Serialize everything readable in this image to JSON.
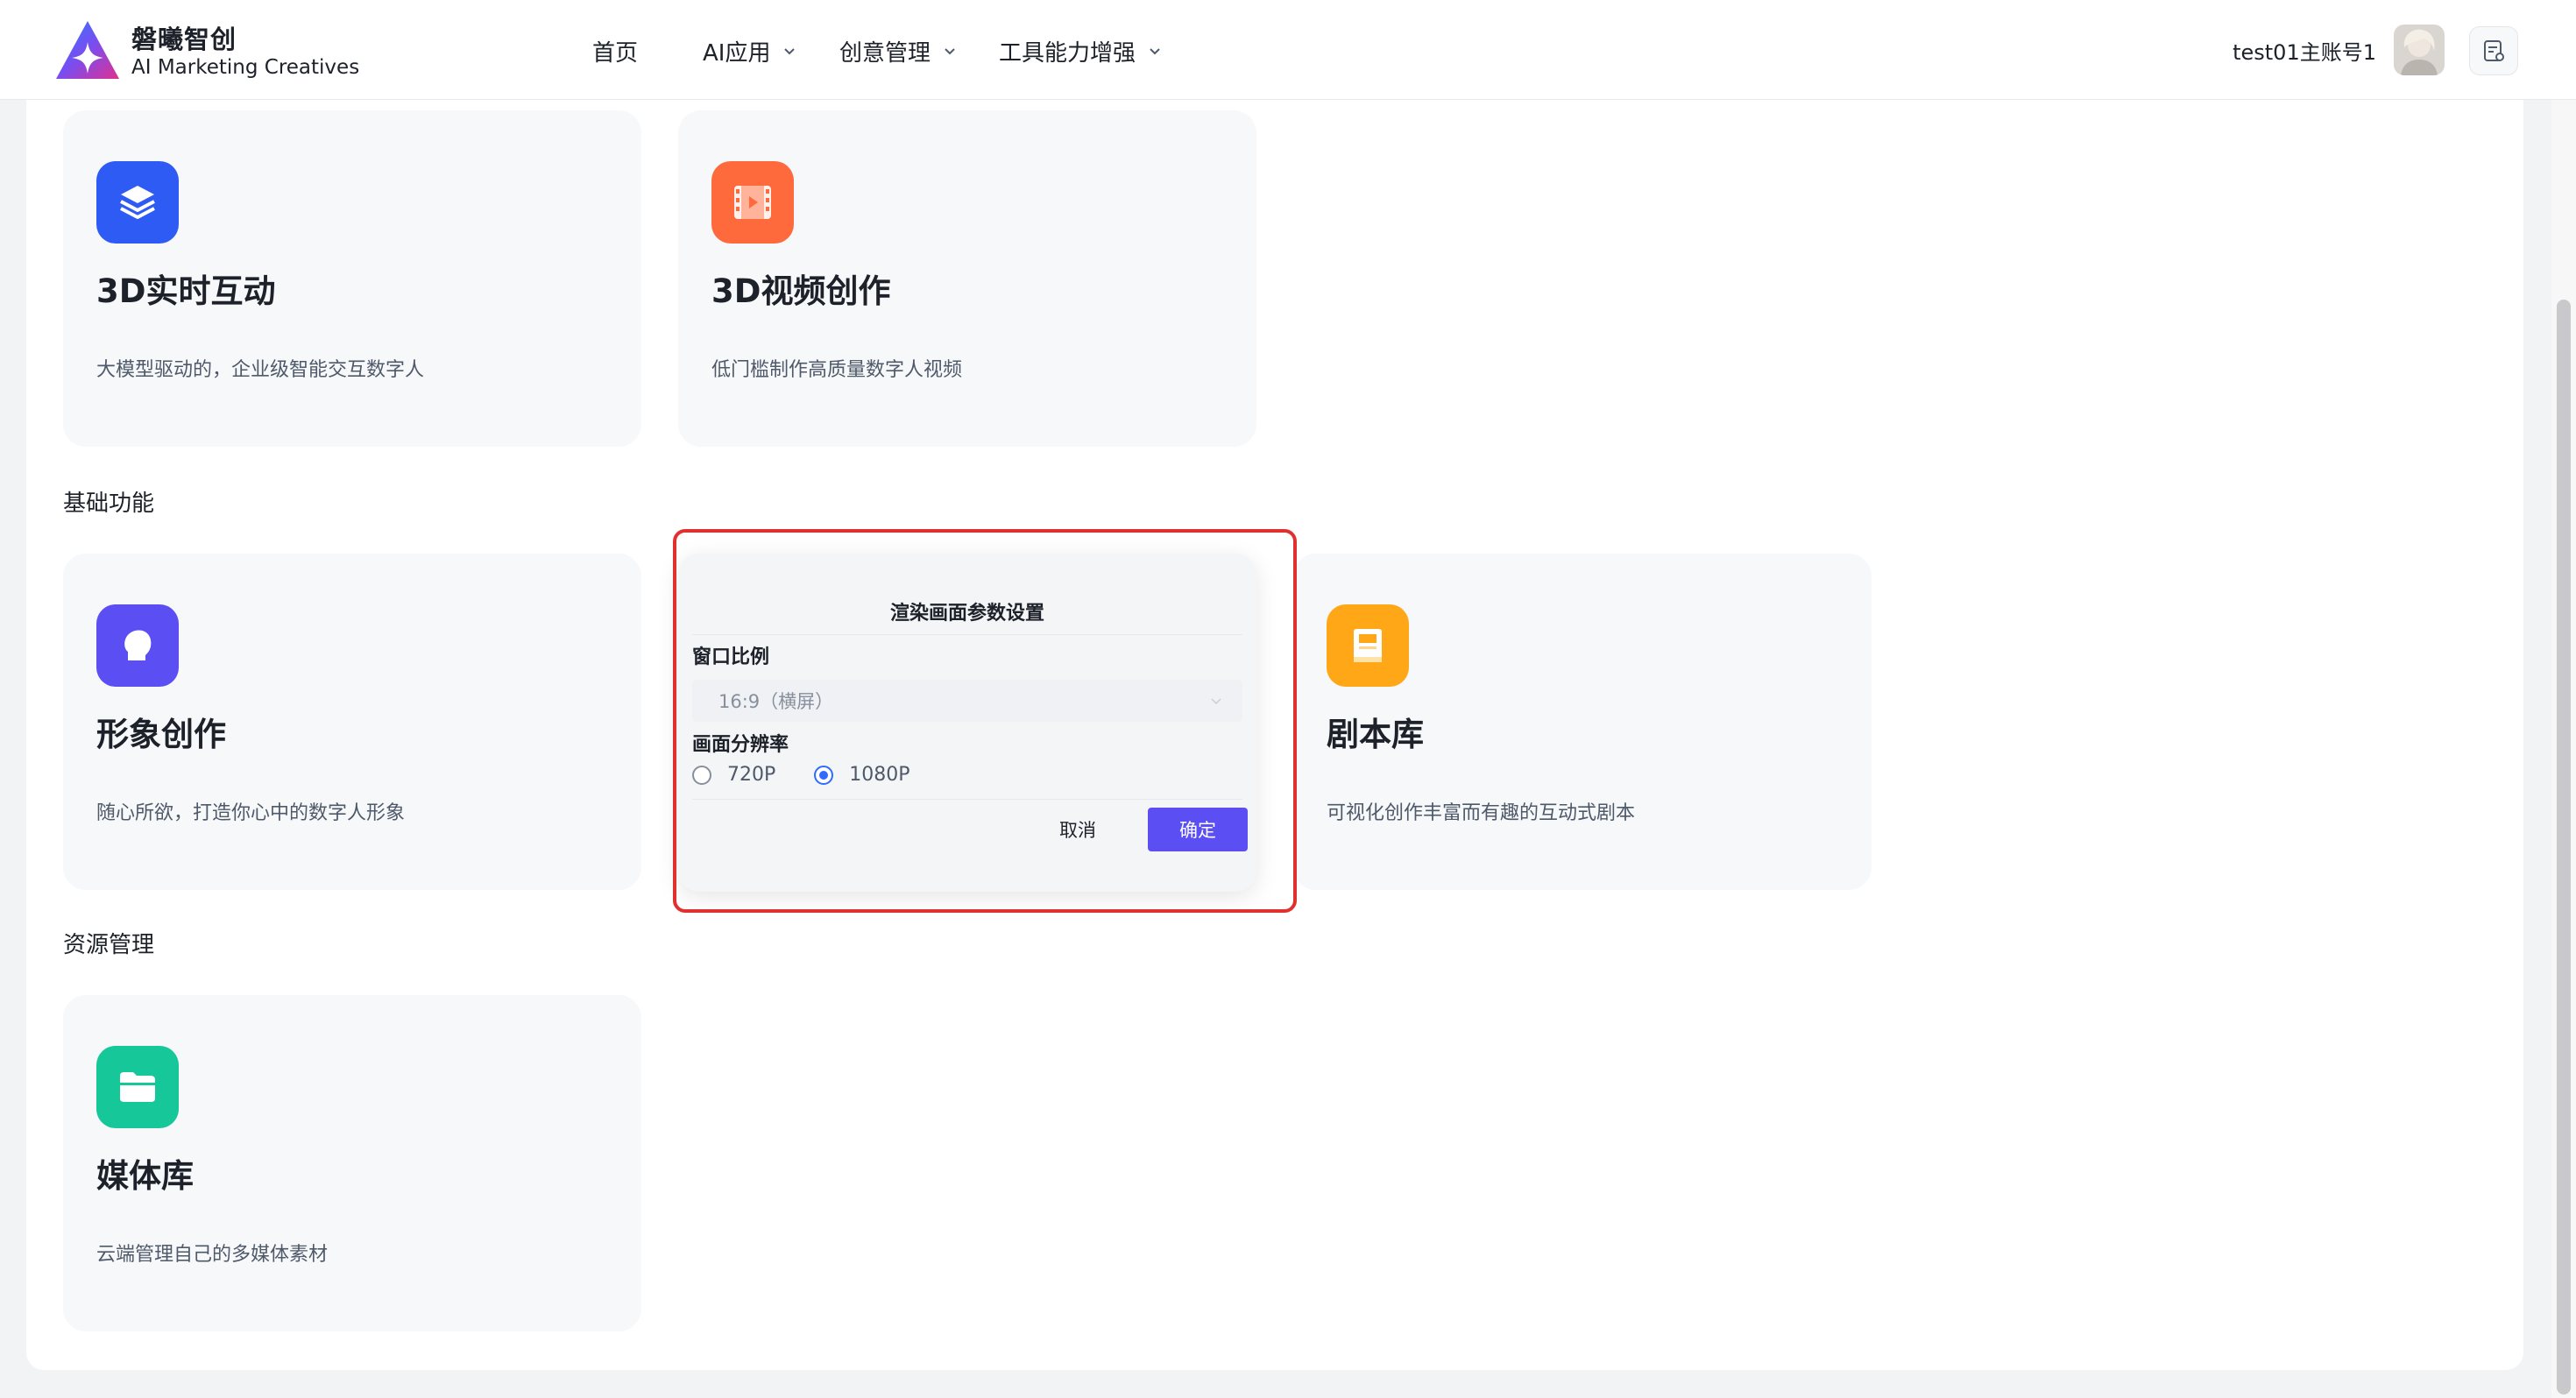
{
  "header": {
    "brand_name": "磐曦智创",
    "brand_sub": "AI Marketing Creatives",
    "nav": [
      {
        "label": "首页"
      },
      {
        "label": "AI应用"
      },
      {
        "label": "创意管理"
      },
      {
        "label": "工具能力增强"
      }
    ],
    "user_name": "test01主账号1"
  },
  "cards_top": [
    {
      "title": "3D实时互动",
      "desc": "大模型驱动的，企业级智能交互数字人",
      "icon": "layers-icon",
      "color": "#2f5bf5"
    },
    {
      "title": "3D视频创作",
      "desc": "低门槛制作高质量数字人视频",
      "icon": "film-icon",
      "color": "#ff6a3d"
    }
  ],
  "sections": {
    "basic": "基础功能",
    "resource": "资源管理"
  },
  "cards_basic": [
    {
      "title": "形象创作",
      "desc": "随心所欲，打造你心中的数字人形象",
      "icon": "person-head-icon",
      "color": "#5b4ef3"
    },
    {
      "title": "剧本库",
      "desc": "可视化创作丰富而有趣的互动式剧本",
      "icon": "book-icon",
      "color": "#ffa716"
    }
  ],
  "cards_resource": [
    {
      "title": "媒体库",
      "desc": "云端管理自己的多媒体素材",
      "icon": "folder-icon",
      "color": "#16c79a"
    }
  ],
  "modal": {
    "title": "渲染画面参数设置",
    "ratio_label": "窗口比例",
    "ratio_value": "16:9（横屏）",
    "resolution_label": "画面分辨率",
    "options": [
      "720P",
      "1080P"
    ],
    "selected": "1080P",
    "cancel": "取消",
    "ok": "确定"
  }
}
